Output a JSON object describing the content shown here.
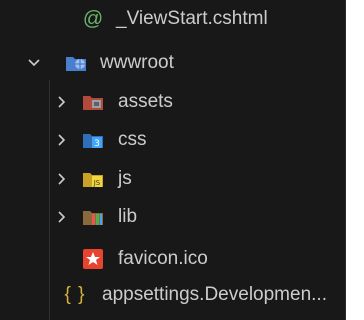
{
  "explorer": {
    "items": [
      {
        "label": "_ViewStart.cshtml",
        "icon": "razor-at-icon"
      },
      {
        "label": "wwwroot",
        "icon": "globe-folder-icon",
        "expanded": true
      },
      {
        "label": "assets",
        "icon": "assets-folder-icon"
      },
      {
        "label": "css",
        "icon": "css-folder-icon"
      },
      {
        "label": "js",
        "icon": "js-folder-icon"
      },
      {
        "label": "lib",
        "icon": "lib-folder-icon"
      },
      {
        "label": "favicon.ico",
        "icon": "favicon-icon"
      },
      {
        "label": "appsettings.Developmen...",
        "icon": "json-braces-icon"
      }
    ]
  },
  "colors": {
    "background": "#181818",
    "text": "#cccccc",
    "razor": "#6bb36b",
    "json": "#d6b23a",
    "favicon": "#e8432e"
  }
}
